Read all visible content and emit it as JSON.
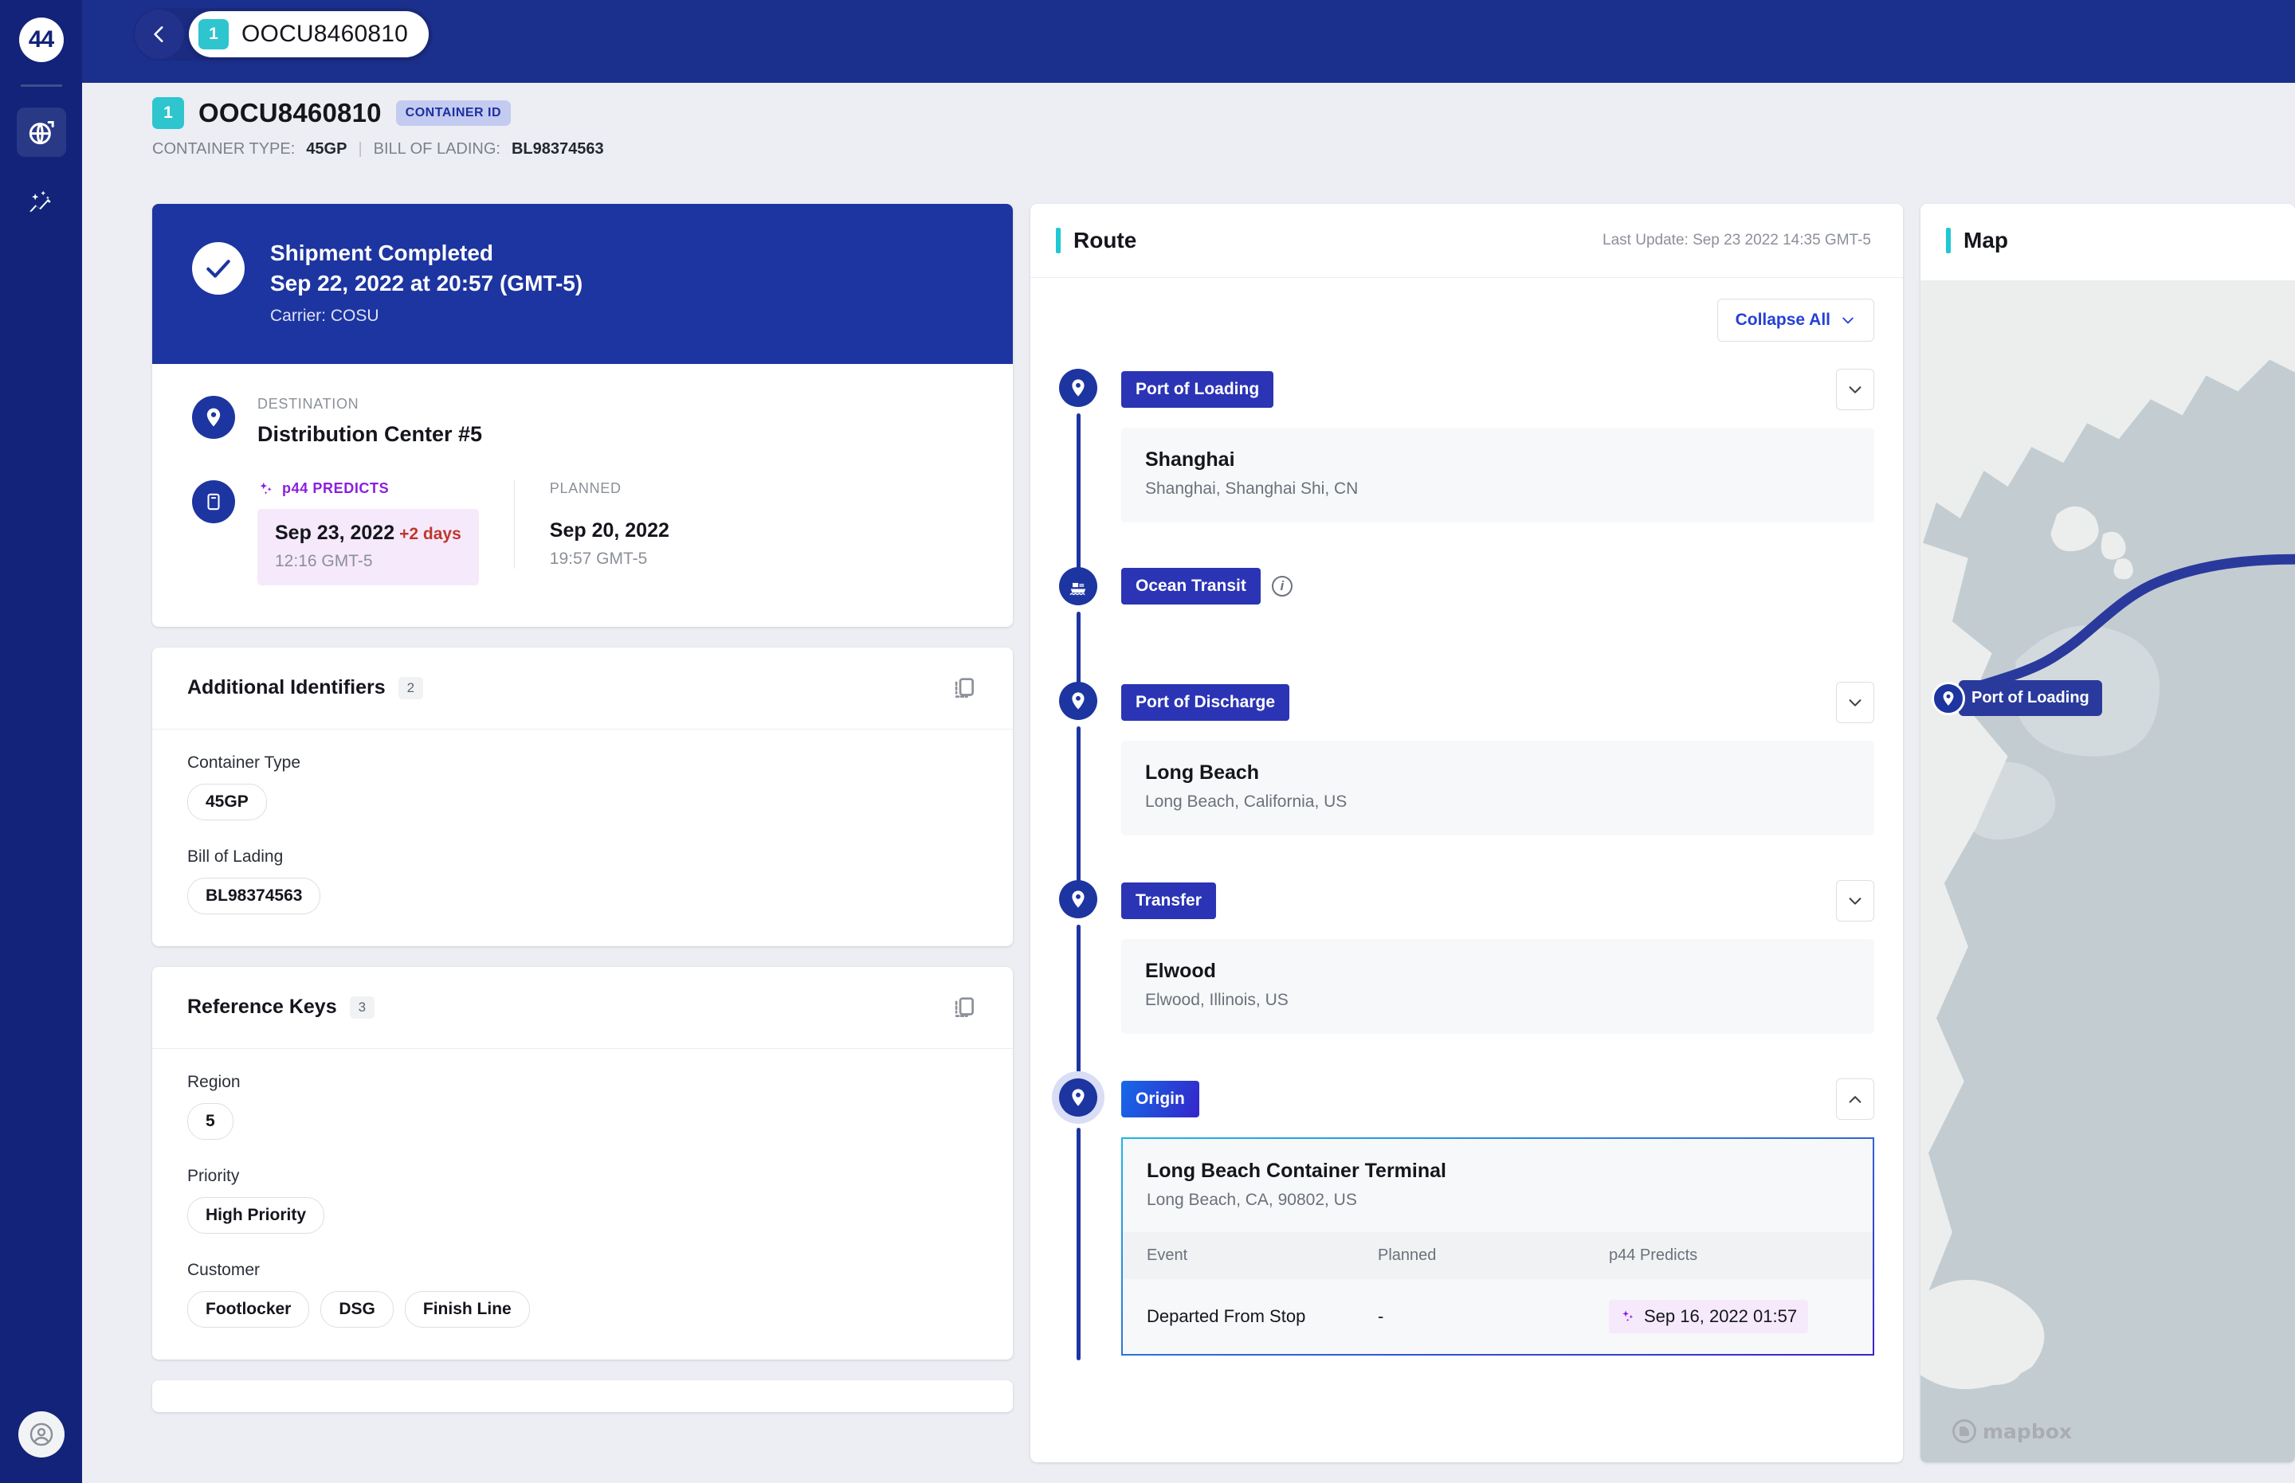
{
  "sidebar": {
    "logo_label": "44",
    "items": [
      {
        "icon": "globe-icon",
        "active": true
      },
      {
        "icon": "sparkle-trend-icon",
        "active": false
      }
    ],
    "avatar_icon": "user-avatar-icon"
  },
  "topbar": {
    "back_icon": "chevron-left-icon",
    "seq_badge": "1",
    "container_id": "OOCU8460810"
  },
  "page_header": {
    "seq_badge": "1",
    "title": "OOCU8460810",
    "tag": "CONTAINER ID",
    "container_type_label": "CONTAINER TYPE:",
    "container_type_value": "45GP",
    "divider": "|",
    "bol_label": "BILL OF LADING:",
    "bol_value": "BL98374563"
  },
  "status_card": {
    "check_icon": "check-icon",
    "title": "Shipment Completed",
    "date": "Sep 22, 2022 at 20:57 (GMT-5)",
    "carrier": "Carrier: COSU",
    "destination_icon": "map-pin-icon",
    "destination_label": "DESTINATION",
    "destination_value": "Distribution Center #5",
    "eta_icon": "calendar-icon",
    "predicts_icon": "sparkle-icon",
    "predicts_label": "p44 PREDICTS",
    "predicts_date": "Sep 23, 2022",
    "predicts_delta": "+2 days",
    "predicts_time": "12:16 GMT-5",
    "planned_label": "PLANNED",
    "planned_date": "Sep 20, 2022",
    "planned_time": "19:57 GMT-5"
  },
  "additional_identifiers": {
    "title": "Additional Identifiers",
    "count": "2",
    "copy_icon": "copy-icon",
    "fields": [
      {
        "label": "Container Type",
        "values": [
          "45GP"
        ]
      },
      {
        "label": "Bill of Lading",
        "values": [
          "BL98374563"
        ]
      }
    ]
  },
  "reference_keys": {
    "title": "Reference Keys",
    "count": "3",
    "copy_icon": "copy-icon",
    "fields": [
      {
        "label": "Region",
        "values": [
          "5"
        ]
      },
      {
        "label": "Priority",
        "values": [
          "High Priority"
        ]
      },
      {
        "label": "Customer",
        "values": [
          "Footlocker",
          "DSG",
          "Finish Line"
        ]
      }
    ]
  },
  "route": {
    "title": "Route",
    "last_update": "Last Update: Sep 23 2022 14:35 GMT-5",
    "collapse_label": "Collapse All",
    "collapse_icon": "chevron-down-icon",
    "stops": [
      {
        "tag": "Port of Loading",
        "marker_icon": "map-pin-icon",
        "chevron": "chevron-down-icon",
        "name": "Shanghai",
        "address": "Shanghai, Shanghai Shi, CN",
        "has_info": false,
        "expanded": false
      },
      {
        "tag": "Ocean Transit",
        "marker_icon": "ship-icon",
        "has_info": true,
        "info_icon": "info-icon",
        "name": "",
        "address": "",
        "expanded": false
      },
      {
        "tag": "Port of Discharge",
        "marker_icon": "map-pin-icon",
        "chevron": "chevron-down-icon",
        "name": "Long Beach",
        "address": "Long Beach, California, US",
        "has_info": false,
        "expanded": false
      },
      {
        "tag": "Transfer",
        "marker_icon": "map-pin-icon",
        "chevron": "chevron-down-icon",
        "name": "Elwood",
        "address": "Elwood, Illinois, US",
        "has_info": false,
        "expanded": false
      },
      {
        "tag": "Origin",
        "marker_icon": "map-pin-icon",
        "chevron": "chevron-up-icon",
        "name": "Long Beach Container Terminal",
        "address": "Long Beach, CA, 90802, US",
        "has_info": false,
        "expanded": true
      }
    ],
    "event_table": {
      "headers": [
        "Event",
        "Planned",
        "p44 Predicts"
      ],
      "rows": [
        {
          "event": "Departed From Stop",
          "planned": "-",
          "predicts": "Sep 16, 2022 01:57",
          "predicts_icon": "sparkle-icon"
        }
      ]
    }
  },
  "map": {
    "title": "Map",
    "marker_label": "Port of Loading",
    "marker_icon": "map-pin-icon",
    "attribution": "mapbox"
  },
  "colors": {
    "rail_bg": "#122379",
    "topbar_bg": "#1b2f8c",
    "primary": "#1d35a0",
    "tag_blue": "#2b34b4",
    "teal": "#2ec5ce",
    "accent_teal": "#1ec8d4",
    "predict_purple": "#8b1ee0",
    "predict_bg": "#f6e9fb",
    "delta_red": "#c0372c",
    "page_bg": "#eceef3",
    "map_water": "#c3cdd1",
    "map_land": "#eceeed",
    "map_route": "#2a3a9c"
  }
}
